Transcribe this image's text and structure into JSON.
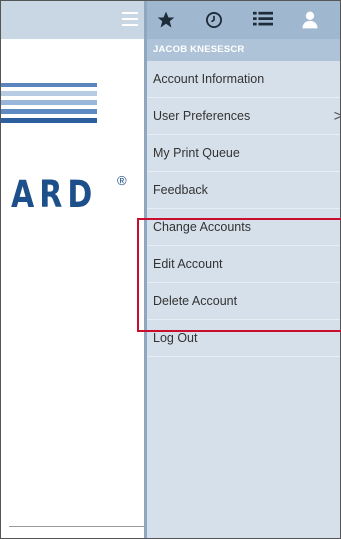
{
  "toolbar": {
    "icons": [
      "star-icon",
      "clock-icon",
      "list-icon",
      "user-icon"
    ]
  },
  "account_menu": {
    "user_name": "JACOB KNESESCR",
    "items": [
      {
        "label": "Account Information"
      },
      {
        "label": "User Preferences",
        "has_submenu": true
      },
      {
        "label": "My Print Queue"
      },
      {
        "label": "Feedback"
      },
      {
        "label": "Change Accounts"
      },
      {
        "label": "Edit Account"
      },
      {
        "label": "Delete Account"
      },
      {
        "label": "Log Out"
      }
    ],
    "submenu_chevron": ">"
  },
  "background_page": {
    "logo_text": "ARD",
    "logo_mark": "®"
  },
  "colors": {
    "panel_bg": "#d6e0ea",
    "icon_bar_bg": "#9fb8cf",
    "highlight": "#c8102e",
    "logo": "#1d4f8a"
  }
}
